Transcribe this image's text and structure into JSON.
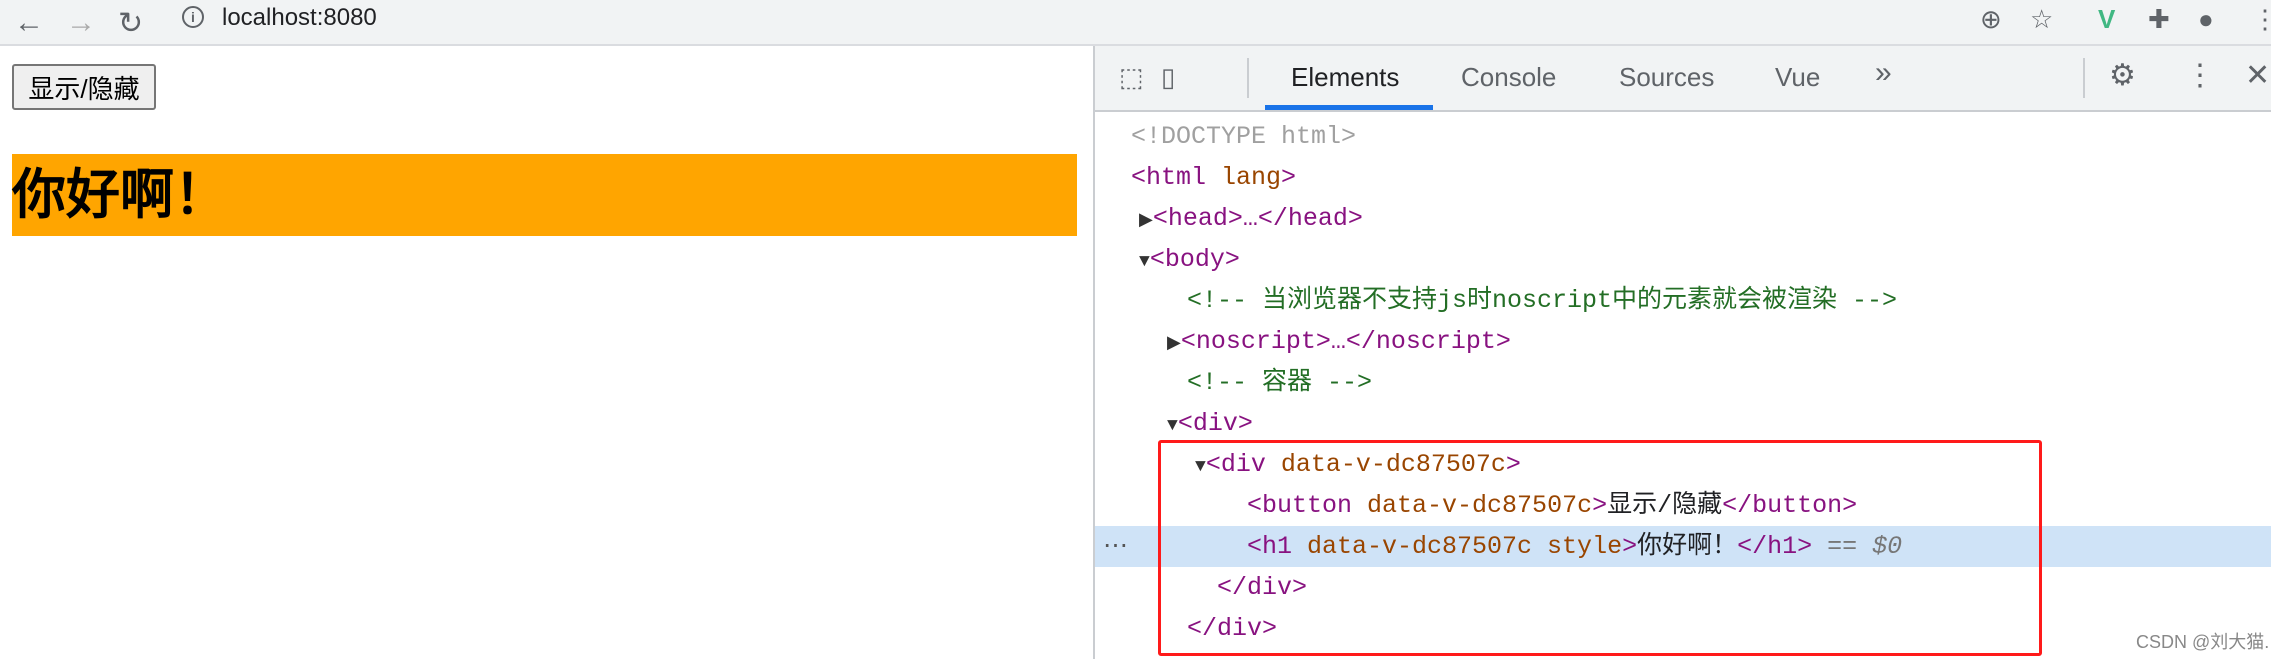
{
  "browser": {
    "url": "localhost:8080"
  },
  "page": {
    "button_label": "显示/隐藏",
    "heading": "你好啊！",
    "heading_bg": "#ffa500"
  },
  "devtools": {
    "tabs": [
      {
        "label": "Elements",
        "active": true
      },
      {
        "label": "Console"
      },
      {
        "label": "Sources"
      },
      {
        "label": "Vue"
      }
    ],
    "more_tabs": "»",
    "tree": {
      "doctype": "<!DOCTYPE html>",
      "html_open": "<html",
      "html_attr": " lang",
      "head": "<head>…</head>",
      "body": "<body>",
      "comment1": "<!-- 当浏览器不支持js时noscript中的元素就会被渲染 -->",
      "noscript": "<noscript>…</noscript>",
      "comment2": "<!-- 容器 -->",
      "div_open": "<div>",
      "inner_div_tag": "<div",
      "inner_div_attr": " data-v-dc87507c",
      "button_tag": "<button",
      "button_attr": " data-v-dc87507c",
      "button_text": "显示/隐藏",
      "button_close": "</button>",
      "h1_tag": "<h1",
      "h1_attr": " data-v-dc87507c style",
      "h1_text": "你好啊！",
      "h1_close": "</h1>",
      "selected_marker": " == $0",
      "inner_div_close": "</div>",
      "div_close": "</div>"
    },
    "highlight_color": "#ff1a1a"
  },
  "watermark": "CSDN @刘大猫."
}
